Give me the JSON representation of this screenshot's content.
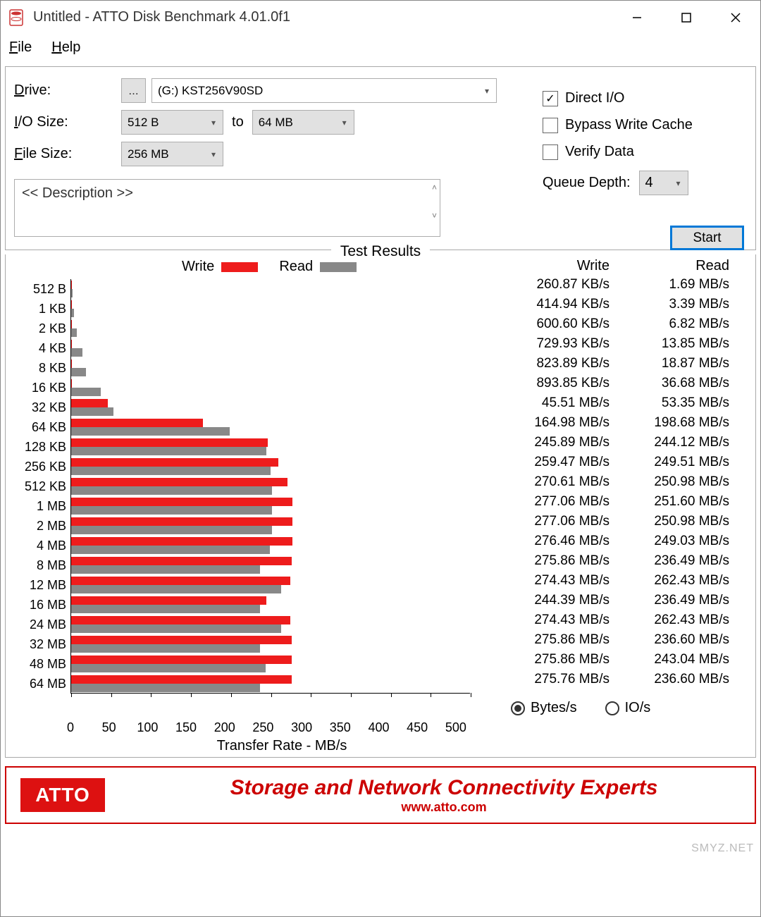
{
  "window": {
    "title": "Untitled - ATTO Disk Benchmark 4.01.0f1"
  },
  "menu": {
    "file": "File",
    "help": "Help"
  },
  "form": {
    "drive_label": "Drive:",
    "drive_browse": "...",
    "drive_value": "(G:) KST256V90SD",
    "io_size_label": "I/O Size:",
    "io_from": "512 B",
    "io_to_label": "to",
    "io_to": "64 MB",
    "file_size_label": "File Size:",
    "file_size": "256 MB",
    "direct_io": "Direct I/O",
    "direct_io_checked": true,
    "bypass": "Bypass Write Cache",
    "bypass_checked": false,
    "verify": "Verify Data",
    "verify_checked": false,
    "queue_label": "Queue Depth:",
    "queue_value": "4",
    "description": "<< Description >>",
    "start": "Start"
  },
  "results": {
    "title": "Test Results",
    "legend_write": "Write",
    "legend_read": "Read",
    "xaxis_label": "Transfer Rate - MB/s",
    "header_write": "Write",
    "header_read": "Read",
    "unit_bytes": "Bytes/s",
    "unit_ios": "IO/s"
  },
  "banner": {
    "logo": "ATTO",
    "line1": "Storage and Network Connectivity Experts",
    "line2": "www.atto.com"
  },
  "watermark": "SMYZ.NET",
  "chart_data": {
    "type": "bar",
    "xlabel": "Transfer Rate - MB/s",
    "xlim": [
      0,
      500
    ],
    "xticks": [
      0,
      50,
      100,
      150,
      200,
      250,
      300,
      350,
      400,
      450,
      500
    ],
    "categories": [
      "512 B",
      "1 KB",
      "2 KB",
      "4 KB",
      "8 KB",
      "16 KB",
      "32 KB",
      "64 KB",
      "128 KB",
      "256 KB",
      "512 KB",
      "1 MB",
      "2 MB",
      "4 MB",
      "8 MB",
      "12 MB",
      "16 MB",
      "24 MB",
      "32 MB",
      "48 MB",
      "64 MB"
    ],
    "series": [
      {
        "name": "Write",
        "color": "#ee1c1c",
        "display": [
          "260.87 KB/s",
          "414.94 KB/s",
          "600.60 KB/s",
          "729.93 KB/s",
          "823.89 KB/s",
          "893.85 KB/s",
          "45.51 MB/s",
          "164.98 MB/s",
          "245.89 MB/s",
          "259.47 MB/s",
          "270.61 MB/s",
          "277.06 MB/s",
          "277.06 MB/s",
          "276.46 MB/s",
          "275.86 MB/s",
          "274.43 MB/s",
          "244.39 MB/s",
          "274.43 MB/s",
          "275.86 MB/s",
          "275.86 MB/s",
          "275.76 MB/s"
        ],
        "values_mb": [
          0.26,
          0.41,
          0.6,
          0.73,
          0.82,
          0.89,
          45.51,
          164.98,
          245.89,
          259.47,
          270.61,
          277.06,
          277.06,
          276.46,
          275.86,
          274.43,
          244.39,
          274.43,
          275.86,
          275.86,
          275.76
        ]
      },
      {
        "name": "Read",
        "color": "#888888",
        "display": [
          "1.69 MB/s",
          "3.39 MB/s",
          "6.82 MB/s",
          "13.85 MB/s",
          "18.87 MB/s",
          "36.68 MB/s",
          "53.35 MB/s",
          "198.68 MB/s",
          "244.12 MB/s",
          "249.51 MB/s",
          "250.98 MB/s",
          "251.60 MB/s",
          "250.98 MB/s",
          "249.03 MB/s",
          "236.49 MB/s",
          "262.43 MB/s",
          "236.49 MB/s",
          "262.43 MB/s",
          "236.60 MB/s",
          "243.04 MB/s",
          "236.60 MB/s"
        ],
        "values_mb": [
          1.69,
          3.39,
          6.82,
          13.85,
          18.87,
          36.68,
          53.35,
          198.68,
          244.12,
          249.51,
          250.98,
          251.6,
          250.98,
          249.03,
          236.49,
          262.43,
          236.49,
          262.43,
          236.6,
          243.04,
          236.6
        ]
      }
    ]
  }
}
